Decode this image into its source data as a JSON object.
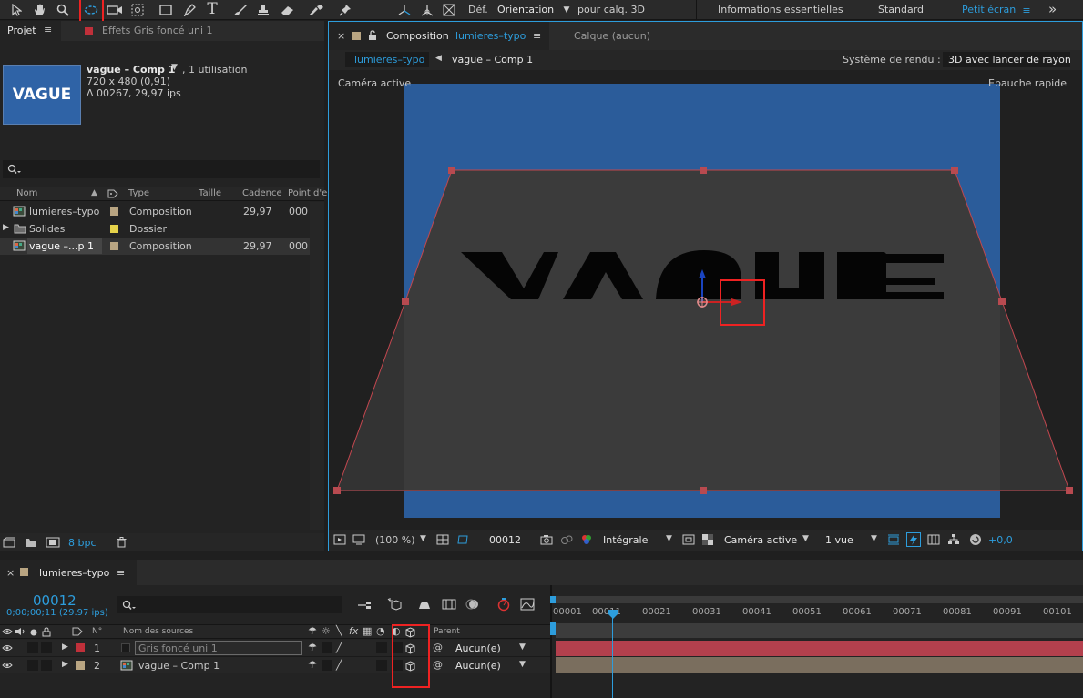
{
  "toolbar": {
    "def_label": "Déf.",
    "orientation_label": "Orientation",
    "pour_calq_label": "pour calq. 3D",
    "workspace_essentials": "Informations essentielles",
    "workspace_standard": "Standard",
    "workspace_small": "Petit écran",
    "overflow": "»"
  },
  "project_panel": {
    "tab_label": "Projet",
    "menu_icon": "≡",
    "effects_tab_label": "Effets  Gris foncé uni 1",
    "thumbnail_text": "VAGUE",
    "item_name": "vague – Comp 1",
    "item_usage": ", 1 utilisation",
    "item_size": "720 x 480 (0,91)",
    "item_duration": "Δ 00267, 29,97 ips",
    "search_placeholder": "",
    "columns": {
      "name": "Nom",
      "type": "Type",
      "size": "Taille",
      "rate": "Cadence",
      "point": "Point d'e"
    },
    "items": [
      {
        "name": "lumieres–typo",
        "type": "Composition",
        "rate": "29,97",
        "point": "000",
        "color": "#b9a582"
      },
      {
        "name": "Solides",
        "type": "Dossier",
        "rate": "",
        "point": "",
        "color": "#e5d24a"
      },
      {
        "name": "vague –...p 1",
        "type": "Composition",
        "rate": "29,97",
        "point": "000",
        "color": "#b9a582"
      }
    ],
    "bpc_label": "8 bpc"
  },
  "comp_panel": {
    "tab_prefix": "Composition",
    "tab_comp_name": "lumieres–typo",
    "layer_tab": "Calque  (aucun)",
    "breadcrumb_active": "lumieres–typo",
    "breadcrumb_next": "vague – Comp 1",
    "renderer_label": "Système de rendu :",
    "renderer_value": "3D avec lancer de rayon",
    "camera_label": "Caméra active",
    "draft_label": "Ebauche rapide",
    "zoom": "(100 %)",
    "timecode": "00012",
    "resolution": "Intégrale",
    "camera_select": "Caméra active",
    "views_select": "1 vue",
    "exposure": "+0,0"
  },
  "timeline": {
    "tab_label": "lumieres–typo",
    "menu_icon": "≡",
    "current_time": "00012",
    "current_time_sub": "0;00;00;11 (29.97 ips)",
    "search_placeholder": "",
    "col_num": "N°",
    "col_source": "Nom des sources",
    "col_parent": "Parent",
    "layers": [
      {
        "num": "1",
        "name": "Gris foncé uni 1",
        "parent": "Aucun(e)",
        "color": "#c0303a"
      },
      {
        "num": "2",
        "name": "vague – Comp 1",
        "parent": "Aucun(e)",
        "color": "#b9a582"
      }
    ],
    "ruler_labels": [
      "00001",
      "00011",
      "00021",
      "00031",
      "00041",
      "00051",
      "00061",
      "00071",
      "00081",
      "00091",
      "00101"
    ]
  },
  "colors": {
    "accent_blue": "#2d9ddc",
    "comp_bg": "#2b5c9a",
    "solid_plane": "#3a3a3a",
    "layer1_bar": "#b3404d",
    "layer2_bar": "#7a6e5e",
    "highlight": "#e22222"
  }
}
